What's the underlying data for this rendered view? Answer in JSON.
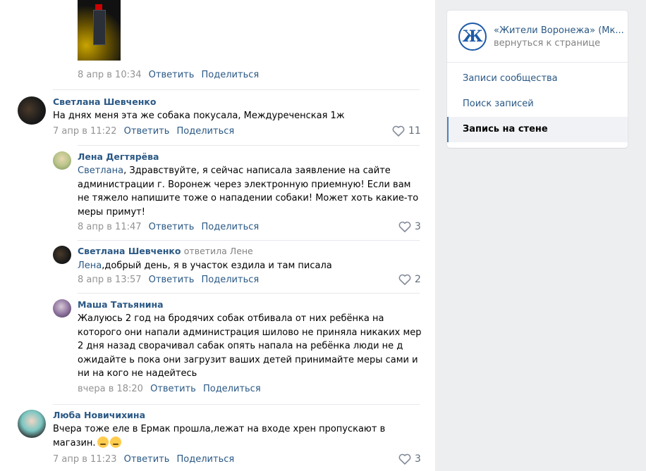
{
  "top_post": {
    "date": "8 апр в 10:34",
    "reply": "Ответить",
    "share": "Поделиться"
  },
  "comments": [
    {
      "author": "Светлана Шевченко",
      "text": "На днях меня эта же собака покусала, Междуреченская 1ж",
      "date": "7 апр в 11:22",
      "reply": "Ответить",
      "share": "Поделиться",
      "likes": "11"
    },
    {
      "author": "Лена Дегтярёва",
      "mention": "Светлана",
      "text_line1": ", Здравствуйте, я сейчас написала заявление на сайте",
      "text_line2": "администрации г. Воронеж через электронную приемную! Если вам",
      "text_line3": "не тяжело напишите тоже о нападении собаки! Может хоть какие-то",
      "text_line4": "меры примут!",
      "date": "8 апр в 11:47",
      "reply": "Ответить",
      "share": "Поделиться",
      "likes": "3"
    },
    {
      "author": "Светлана Шевченко",
      "replied": "ответила Лене",
      "mention": "Лена",
      "text": ",добрый день, я в участок ездила и там писала",
      "date": "8 апр в 13:57",
      "reply": "Ответить",
      "share": "Поделиться",
      "likes": "2"
    },
    {
      "author": "Маша Татьянина",
      "text_line1": "Жалуюсь 2 год на бродячих собак отбивала от них ребёнка на",
      "text_line2": "которого они напали администрация шилово не приняла никаких мер",
      "text_line3": "2 дня назад сворачивал сабак опять напала на ребёнка люди не д",
      "text_line4": "ожидайте ь пока они загрузит ваших детей принимайте меры сами и",
      "text_line5": "ни на кого не надейтесь",
      "date": "вчера в 18:20",
      "reply": "Ответить",
      "share": "Поделиться"
    },
    {
      "author": "Люба Новичихина",
      "text_line1": "Вчера тоже еле в Ермак прошла,лежат на входе хрен пропускают в",
      "text_line2": "магазин.",
      "date": "7 апр в 11:23",
      "reply": "Ответить",
      "share": "Поделиться",
      "likes": "3"
    }
  ],
  "sidebar": {
    "community_logo_letter": "Ж",
    "community_name": "«Жители Воронежа» (Мк...",
    "back_link": "вернуться к странице",
    "menu": [
      {
        "label": "Записи сообщества"
      },
      {
        "label": "Поиск записей"
      },
      {
        "label": "Запись на стене"
      }
    ]
  },
  "colors": {
    "link": "#2a5885",
    "meta": "#828282",
    "background": "#edeef0"
  }
}
